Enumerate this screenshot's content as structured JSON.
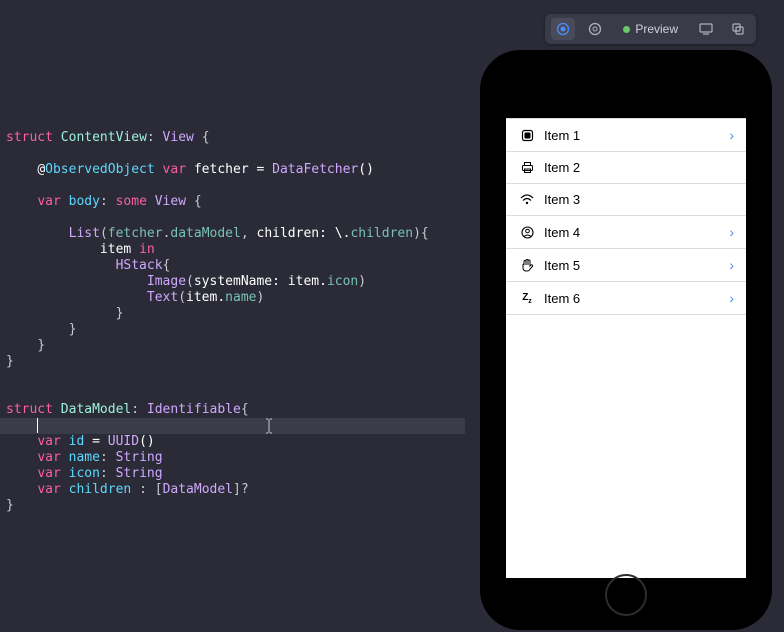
{
  "code": {
    "struct_kw": "struct",
    "var_kw": "var",
    "some_kw": "some",
    "in_kw": "in",
    "at": "@",
    "contentview": "ContentView",
    "view": "View",
    "observed": "ObservedObject",
    "fetcher_var": "fetcher",
    "datafetcher": "DataFetcher",
    "body": "body",
    "list": "List",
    "datamodel_prop": "dataModel",
    "children": "children",
    "item": "item",
    "hstack": "HStack",
    "image": "Image",
    "systemname": "systemName",
    "icon_prop": "icon",
    "text": "Text",
    "name_prop": "name",
    "datamodel": "DataModel",
    "identifiable": "Identifiable",
    "id": "id",
    "uuid": "UUID",
    "name": "name",
    "string": "String",
    "icon": "icon",
    "brace_open": "{",
    "brace_close": "}",
    "paren_open": "(",
    "paren_close": ")",
    "colon": ":",
    "comma": ",",
    "equals": " = ",
    "dot": ".",
    "backslash_dot": "\\.",
    "opt": "?",
    "brack_open": "[",
    "brack_close": "]"
  },
  "toolbar": {
    "preview_label": "Preview"
  },
  "list": {
    "items": [
      {
        "label": "Item 1",
        "icon": "square-fill",
        "expandable": true
      },
      {
        "label": "Item 2",
        "icon": "printer",
        "expandable": false
      },
      {
        "label": "Item 3",
        "icon": "wifi",
        "expandable": false
      },
      {
        "label": "Item 4",
        "icon": "person-circle",
        "expandable": true
      },
      {
        "label": "Item 5",
        "icon": "hand",
        "expandable": true
      },
      {
        "label": "Item 6",
        "icon": "zzz",
        "expandable": true
      }
    ]
  }
}
